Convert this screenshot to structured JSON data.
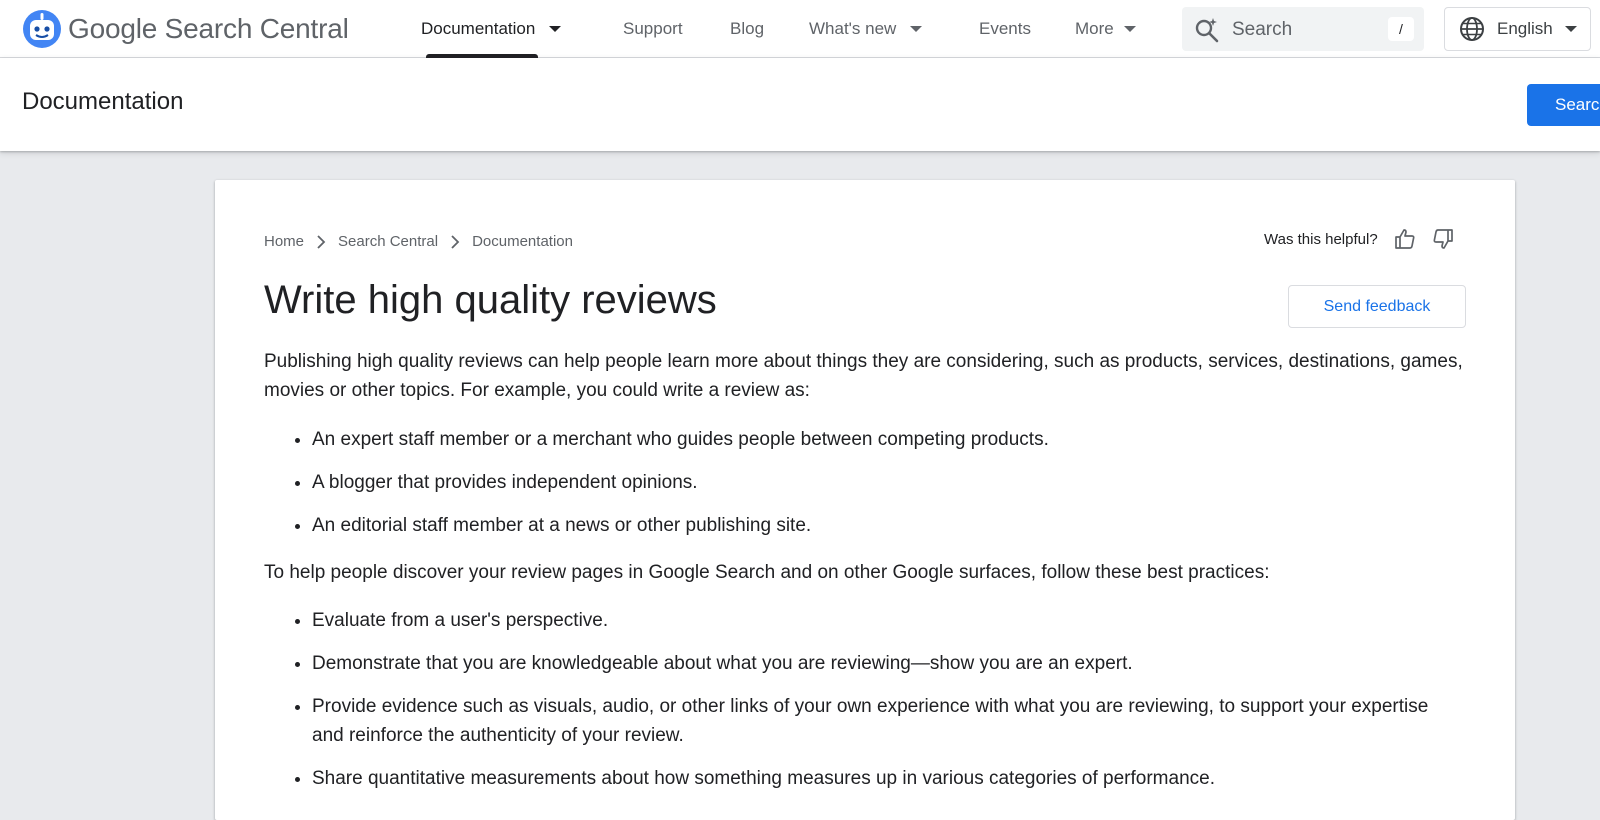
{
  "topbar": {
    "logo_text": "Google Search Central",
    "nav": [
      {
        "label": "Documentation",
        "has_caret": true,
        "active": true
      },
      {
        "label": "Support",
        "has_caret": false
      },
      {
        "label": "Blog",
        "has_caret": false
      },
      {
        "label": "What's new",
        "has_caret": true
      },
      {
        "label": "Events",
        "has_caret": false
      },
      {
        "label": "More",
        "has_caret": true
      }
    ],
    "search_placeholder": "Search",
    "search_shortcut": "/",
    "language": "English"
  },
  "subheader": {
    "title": "Documentation",
    "cta_label": "Search"
  },
  "article": {
    "breadcrumb": [
      "Home",
      "Search Central",
      "Documentation"
    ],
    "helpful_label": "Was this helpful?",
    "title": "Write high quality reviews",
    "feedback_label": "Send feedback",
    "intro": "Publishing high quality reviews can help people learn more about things they are considering, such as products, services, destinations, games, movies or other topics. For example, you could write a review as:",
    "roles": [
      "An expert staff member or a merchant who guides people between competing products.",
      "A blogger that provides independent opinions.",
      "An editorial staff member at a news or other publishing site."
    ],
    "practices_intro": "To help people discover your review pages in Google Search and on other Google surfaces, follow these best practices:",
    "practices": [
      "Evaluate from a user's perspective.",
      "Demonstrate that you are knowledgeable about what you are reviewing—show you are an expert.",
      "Provide evidence such as visuals, audio, or other links of your own experience with what you are reviewing, to support your expertise and reinforce the authenticity of your review.",
      "Share quantitative measurements about how something measures up in various categories of performance."
    ]
  },
  "colors": {
    "accent": "#1a73e8",
    "background": "#e8eaed",
    "text": "#202124",
    "muted": "#5f6368"
  },
  "icons": {
    "logo": "search-central-robot-icon",
    "search": "search-sparkle-icon",
    "language": "globe-icon",
    "thumbs_up": "thumb-up-icon",
    "thumbs_down": "thumb-down-icon",
    "breadcrumb_separator": "chevron-right-icon"
  }
}
